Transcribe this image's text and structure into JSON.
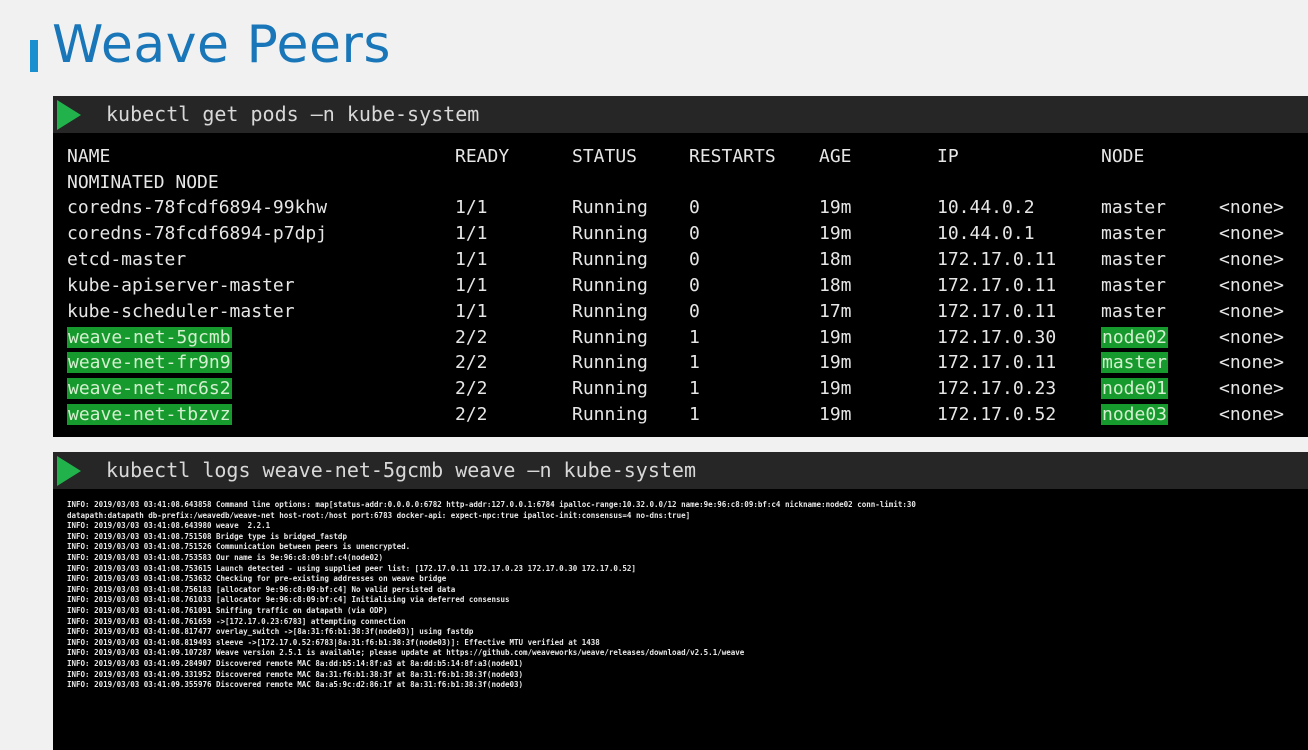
{
  "slide": {
    "title": "Weave Peers"
  },
  "terminal1": {
    "command": "kubectl get pods –n kube-system",
    "headers": [
      "NAME",
      "READY",
      "STATUS",
      "RESTARTS",
      "AGE",
      "IP",
      "NODE"
    ],
    "header_second_line": "NOMINATED NODE",
    "rows": [
      {
        "name": "coredns-78fcdf6894-99khw",
        "ready": "1/1",
        "status": "Running",
        "restarts": "0",
        "age": "19m",
        "ip": "10.44.0.2",
        "node": "master",
        "nominated": "<none>",
        "highlight": false
      },
      {
        "name": "coredns-78fcdf6894-p7dpj",
        "ready": "1/1",
        "status": "Running",
        "restarts": "0",
        "age": "19m",
        "ip": "10.44.0.1",
        "node": "master",
        "nominated": "<none>",
        "highlight": false
      },
      {
        "name": "etcd-master",
        "ready": "1/1",
        "status": "Running",
        "restarts": "0",
        "age": "18m",
        "ip": "172.17.0.11",
        "node": "master",
        "nominated": "<none>",
        "highlight": false
      },
      {
        "name": "kube-apiserver-master",
        "ready": "1/1",
        "status": "Running",
        "restarts": "0",
        "age": "18m",
        "ip": "172.17.0.11",
        "node": "master",
        "nominated": "<none>",
        "highlight": false
      },
      {
        "name": "kube-scheduler-master",
        "ready": "1/1",
        "status": "Running",
        "restarts": "0",
        "age": "17m",
        "ip": "172.17.0.11",
        "node": "master",
        "nominated": "<none>",
        "highlight": false
      },
      {
        "name": "weave-net-5gcmb",
        "ready": "2/2",
        "status": "Running",
        "restarts": "1",
        "age": "19m",
        "ip": "172.17.0.30",
        "node": "node02",
        "nominated": "<none>",
        "highlight": true
      },
      {
        "name": "weave-net-fr9n9",
        "ready": "2/2",
        "status": "Running",
        "restarts": "1",
        "age": "19m",
        "ip": "172.17.0.11",
        "node": "master",
        "nominated": "<none>",
        "highlight": true
      },
      {
        "name": "weave-net-mc6s2",
        "ready": "2/2",
        "status": "Running",
        "restarts": "1",
        "age": "19m",
        "ip": "172.17.0.23",
        "node": "node01",
        "nominated": "<none>",
        "highlight": true
      },
      {
        "name": "weave-net-tbzvz",
        "ready": "2/2",
        "status": "Running",
        "restarts": "1",
        "age": "19m",
        "ip": "172.17.0.52",
        "node": "node03",
        "nominated": "<none>",
        "highlight": true
      }
    ]
  },
  "terminal2": {
    "command": "kubectl logs weave-net-5gcmb weave –n kube-system",
    "lines": [
      "INFO: 2019/03/03 03:41:08.643858 Command line options: map[status-addr:0.0.0.0:6782 http-addr:127.0.0.1:6784 ipalloc-range:10.32.0.0/12 name:9e:96:c8:09:bf:c4 nickname:node02 conn-limit:30",
      "datapath:datapath db-prefix:/weavedb/weave-net host-root:/host port:6783 docker-api: expect-npc:true ipalloc-init:consensus=4 no-dns:true]",
      "INFO: 2019/03/03 03:41:08.643980 weave  2.2.1",
      "INFO: 2019/03/03 03:41:08.751508 Bridge type is bridged_fastdp",
      "INFO: 2019/03/03 03:41:08.751526 Communication between peers is unencrypted.",
      "INFO: 2019/03/03 03:41:08.753583 Our name is 9e:96:c8:09:bf:c4(node02)",
      "INFO: 2019/03/03 03:41:08.753615 Launch detected - using supplied peer list: [172.17.0.11 172.17.0.23 172.17.0.30 172.17.0.52]",
      "INFO: 2019/03/03 03:41:08.753632 Checking for pre-existing addresses on weave bridge",
      "INFO: 2019/03/03 03:41:08.756183 [allocator 9e:96:c8:09:bf:c4] No valid persisted data",
      "INFO: 2019/03/03 03:41:08.761033 [allocator 9e:96:c8:09:bf:c4] Initialising via deferred consensus",
      "INFO: 2019/03/03 03:41:08.761091 Sniffing traffic on datapath (via ODP)",
      "INFO: 2019/03/03 03:41:08.761659 ->[172.17.0.23:6783] attempting connection",
      "INFO: 2019/03/03 03:41:08.817477 overlay_switch ->[8a:31:f6:b1:38:3f(node03)] using fastdp",
      "INFO: 2019/03/03 03:41:08.819493 sleeve ->[172.17.0.52:6783|8a:31:f6:b1:38:3f(node03)]: Effective MTU verified at 1438",
      "INFO: 2019/03/03 03:41:09.107287 Weave version 2.5.1 is available; please update at https://github.com/weaveworks/weave/releases/download/v2.5.1/weave",
      "INFO: 2019/03/03 03:41:09.284907 Discovered remote MAC 8a:dd:b5:14:8f:a3 at 8a:dd:b5:14:8f:a3(node01)",
      "INFO: 2019/03/03 03:41:09.331952 Discovered remote MAC 8a:31:f6:b1:38:3f at 8a:31:f6:b1:38:3f(node03)",
      "INFO: 2019/03/03 03:41:09.355976 Discovered remote MAC 8a:a5:9c:d2:86:1f at 8a:31:f6:b1:38:3f(node03)"
    ]
  },
  "colors": {
    "title": "#1976b8",
    "accent_bar": "#1a8fd0",
    "highlight": "#169a2e",
    "play_icon": "#22b24c"
  }
}
